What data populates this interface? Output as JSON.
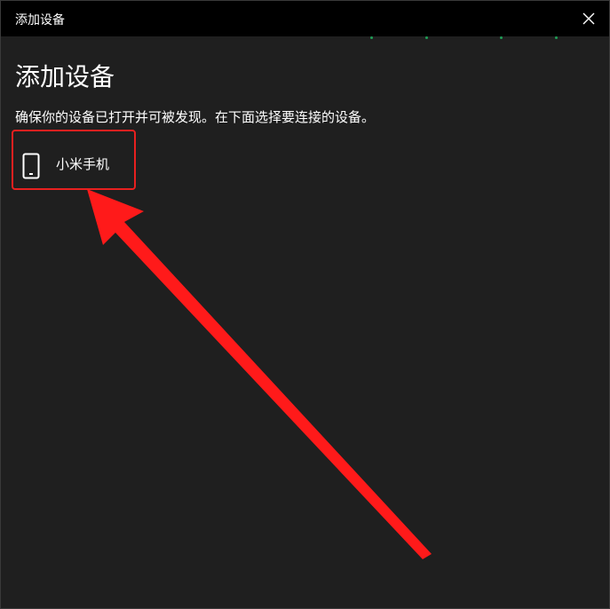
{
  "window": {
    "title": "添加设备",
    "close_glyph": "✕"
  },
  "main": {
    "heading": "添加设备",
    "instructions": "确保你的设备已打开并可被发现。在下面选择要连接的设备。",
    "devices": [
      {
        "label": "小米手机",
        "icon": "phone-icon"
      }
    ]
  },
  "annotation": {
    "highlight_color": "#e8201f",
    "arrow_color": "#ff1a1a"
  }
}
